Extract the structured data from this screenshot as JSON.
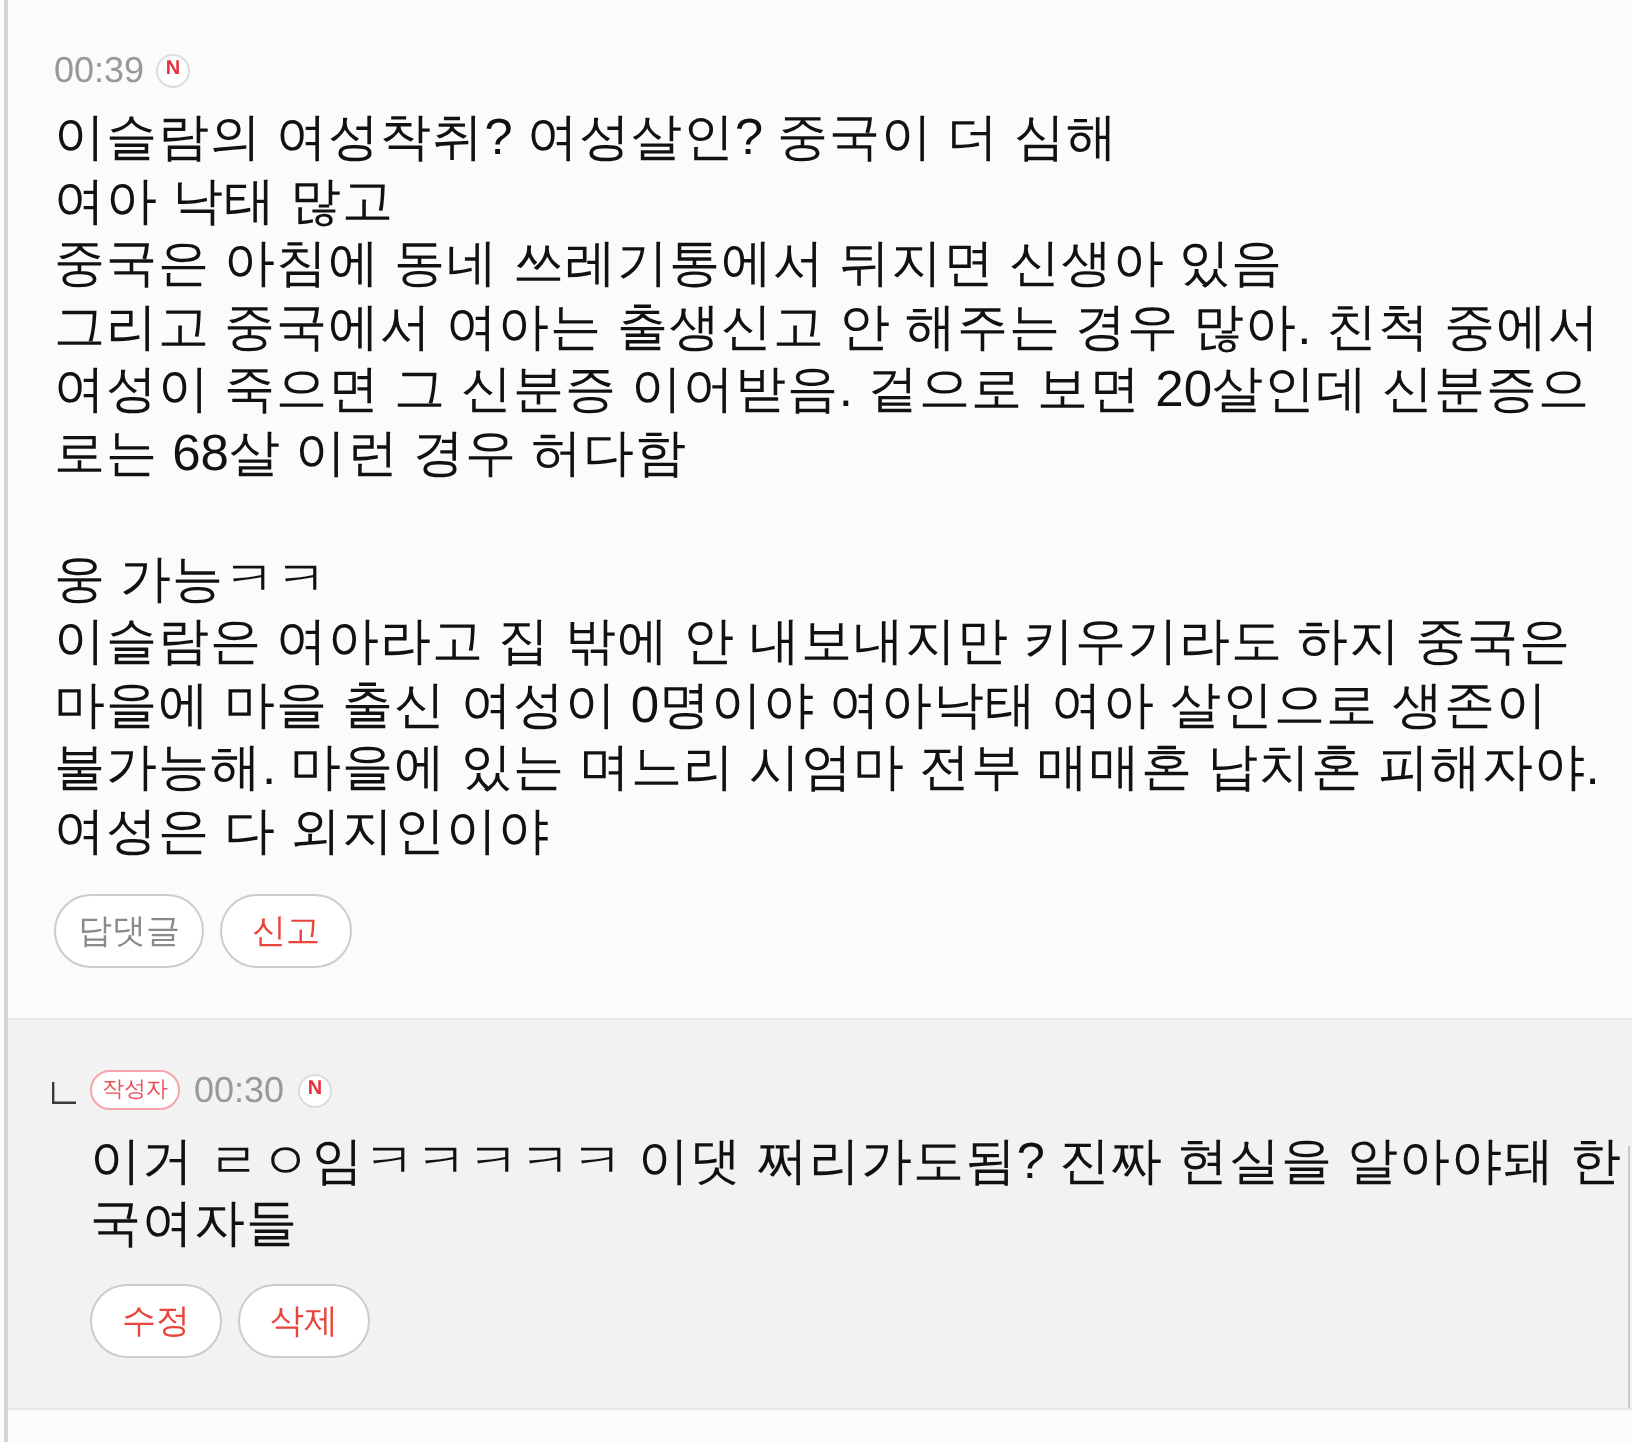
{
  "comment": {
    "time": "00:39",
    "new_badge": "N",
    "paragraphs": [
      [
        "이슬람의 여성착취? 여성살인? 중국이 더 심해",
        "여아 낙태 많고",
        "중국은 아침에 동네 쓰레기통에서 뒤지면 신생아 있음",
        "그리고 중국에서 여아는 출생신고 안 해주는 경우 많아. 친척 중에서",
        "여성이 죽으면 그 신분증 이어받음. 겉으로 보면 20살인데 신분증으",
        "로는 68살 이런 경우 허다함"
      ],
      [
        "웅 가능ㅋㅋ",
        "이슬람은 여아라고 집 밖에 안 내보내지만 키우기라도 하지 중국은",
        "마을에 마을 출신 여성이 0명이야 여아낙태 여아 살인으로 생존이",
        "불가능해. 마을에 있는 며느리 시엄마 전부 매매혼 납치혼 피해자야.",
        "여성은 다 외지인이야"
      ]
    ],
    "buttons": [
      {
        "label": "답댓글",
        "kind": "plain"
      },
      {
        "label": "신고",
        "kind": "alert"
      }
    ]
  },
  "replies": [
    {
      "author_tag": "작성자",
      "time": "00:30",
      "new_badge": "N",
      "lines": [
        "이거 ㄹㅇ임ㅋㅋㅋㅋㅋ 이댓 쩌리가도됨? 진짜 현실을 알아야돼 한",
        "국여자들"
      ],
      "buttons": [
        {
          "label": "수정",
          "kind": "alert"
        },
        {
          "label": "삭제",
          "kind": "alert"
        }
      ]
    }
  ]
}
